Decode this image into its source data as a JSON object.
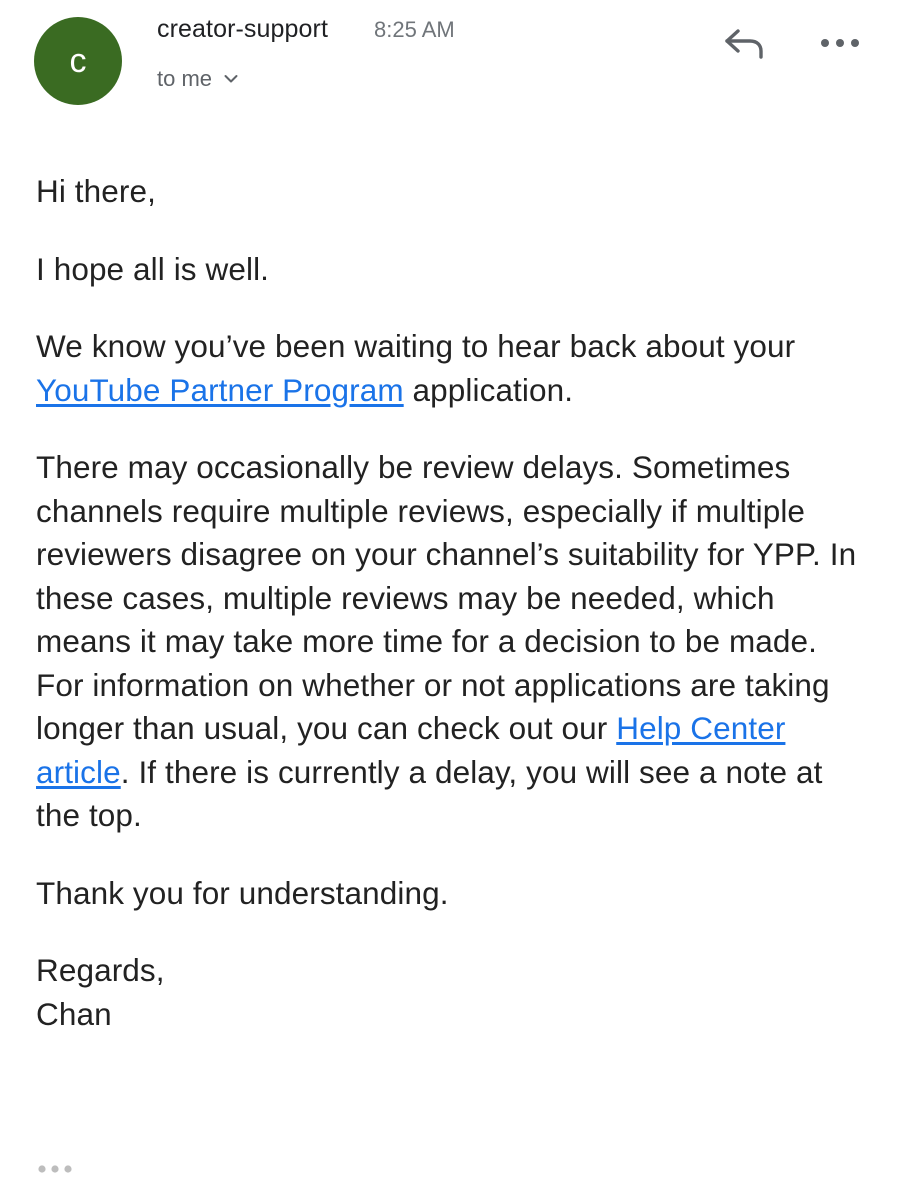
{
  "header": {
    "avatar_letter": "c",
    "avatar_color": "#3a6b22",
    "sender": "creator-support",
    "time": "8:25 AM",
    "recipient": "to me",
    "icons": [
      "chevron-down-icon",
      "reply-icon",
      "more-horizontal-icon"
    ]
  },
  "body": {
    "greeting": "Hi there,",
    "line2": "I hope all is well.",
    "p3": {
      "before": "We know you’ve been waiting to hear back about your ",
      "link": "YouTube Partner Program",
      "after": " application."
    },
    "p4": {
      "before": "There may occasionally be review delays. Sometimes channels require multiple reviews, especially if multiple reviewers disagree on your channel’s suitability for YPP. In these cases, multiple reviews may be needed, which means it may take more time for a decision to be made. For information on whether or not applications are taking longer than usual, you can check out our ",
      "link": "Help Center article",
      "after": ". If there is currently a delay, you will see a note at the top."
    },
    "thanks": "Thank you for understanding.",
    "signoff": "Regards,",
    "signature": "Chan"
  },
  "footer": {
    "trimmed_icon": "ellipsis-icon"
  },
  "colors": {
    "link": "#1a73e8",
    "text": "#222222",
    "meta": "#70757a"
  }
}
